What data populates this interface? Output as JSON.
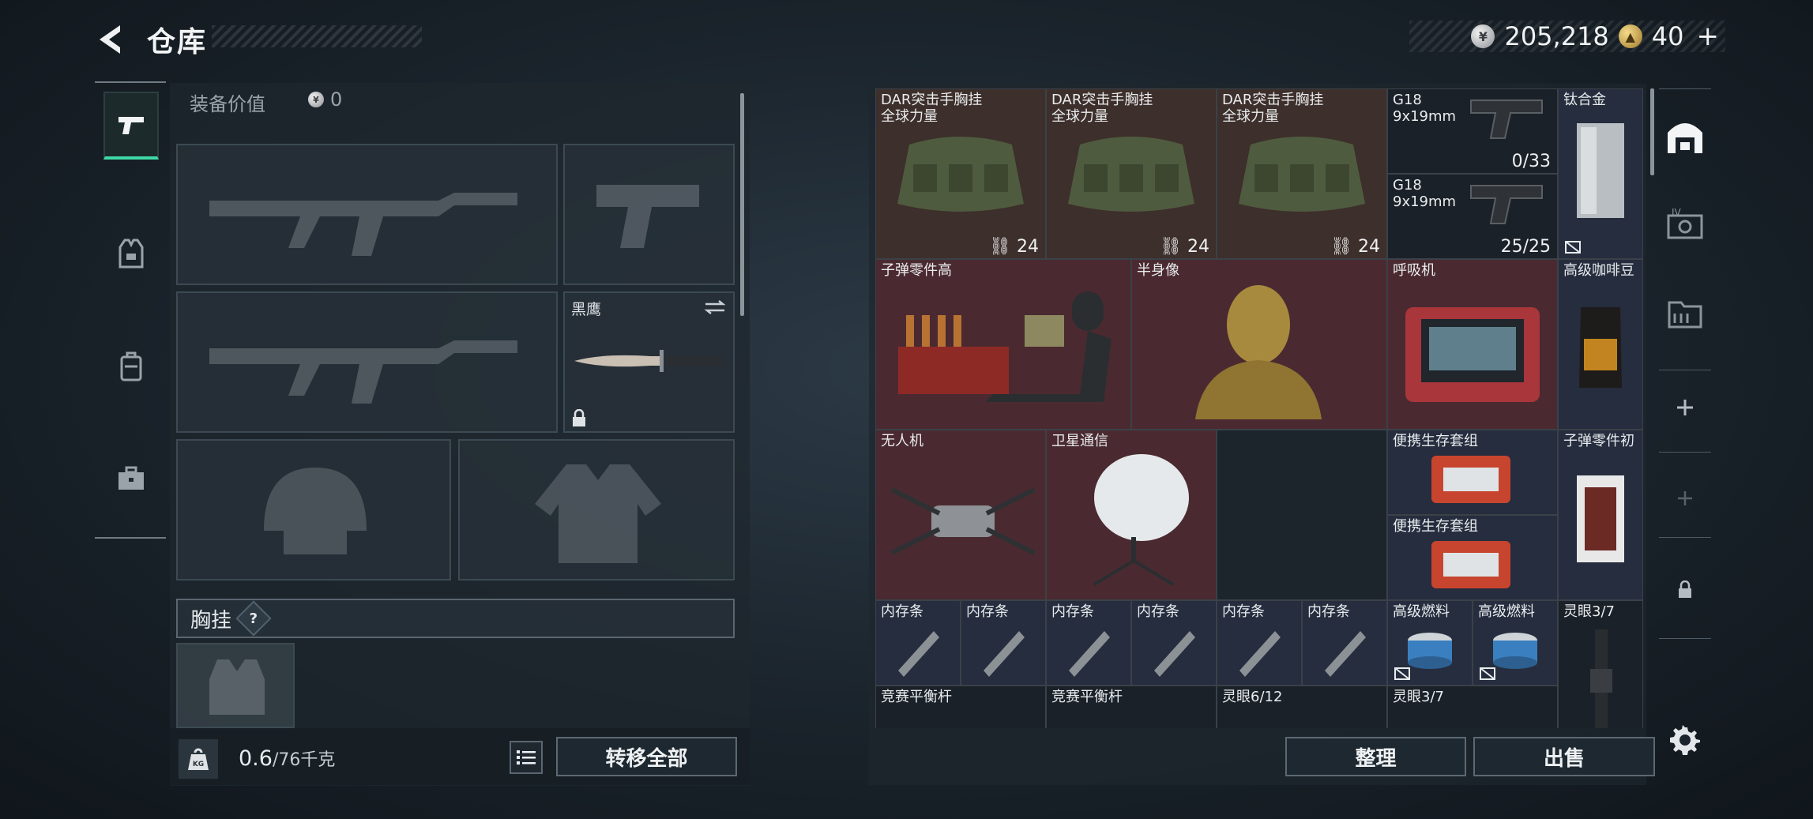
{
  "header": {
    "title": "仓库",
    "silver_amount": "205,218",
    "gold_amount": "40",
    "gold_plus": "+"
  },
  "left_panel": {
    "equip_value_label": "装备价值",
    "equip_value": "0",
    "melee_slot_name": "黑鹰",
    "chest_label": "胸挂",
    "chest_help": "?",
    "weight_current": "0.6",
    "weight_max": "/76千克",
    "transfer_all": "转移全部"
  },
  "right_panel": {
    "items": [
      {
        "name": "DAR突击手胸挂\n全球力量",
        "count": "24"
      },
      {
        "name": "DAR突击手胸挂\n全球力量",
        "count": "24"
      },
      {
        "name": "DAR突击手胸挂\n全球力量",
        "count": "24"
      },
      {
        "name": "G18\n9x19mm",
        "count": "0/33"
      },
      {
        "name": "钛合金",
        "count": ""
      },
      {
        "name": "G18\n9x19mm",
        "count": "25/25"
      },
      {
        "name": "子弹零件高",
        "count": ""
      },
      {
        "name": "半身像",
        "count": ""
      },
      {
        "name": "呼吸机",
        "count": ""
      },
      {
        "name": "高级咖啡豆",
        "count": ""
      },
      {
        "name": "无人机",
        "count": ""
      },
      {
        "name": "卫星通信",
        "count": ""
      },
      {
        "name": "便携生存套组",
        "count": ""
      },
      {
        "name": "子弹零件初",
        "count": ""
      },
      {
        "name": "便携生存套组",
        "count": ""
      },
      {
        "name": "内存条",
        "count": ""
      },
      {
        "name": "内存条",
        "count": ""
      },
      {
        "name": "内存条",
        "count": ""
      },
      {
        "name": "内存条",
        "count": ""
      },
      {
        "name": "内存条",
        "count": ""
      },
      {
        "name": "内存条",
        "count": ""
      },
      {
        "name": "高级燃料",
        "count": ""
      },
      {
        "name": "高级燃料",
        "count": ""
      },
      {
        "name": "灵眼3/7",
        "count": ""
      },
      {
        "name": "竞赛平衡杆",
        "count": ""
      },
      {
        "name": "竞赛平衡杆",
        "count": ""
      },
      {
        "name": "灵眼6/12",
        "count": ""
      },
      {
        "name": "灵眼3/7",
        "count": ""
      }
    ],
    "sort_button": "整理",
    "sell_button": "出售"
  },
  "colors": {
    "accent": "#3fd9a6",
    "brown_cell": "#3d2f2b",
    "red_cell": "#4a2a30",
    "navy_cell": "#252d3e"
  },
  "icons": [
    "back-arrow-icon",
    "silver-coin-icon",
    "gold-coin-icon",
    "pistol-icon",
    "vest-icon",
    "backpack-icon",
    "toolbox-icon",
    "weight-icon",
    "list-icon",
    "warehouse-icon",
    "lock-icon",
    "gear-icon"
  ]
}
